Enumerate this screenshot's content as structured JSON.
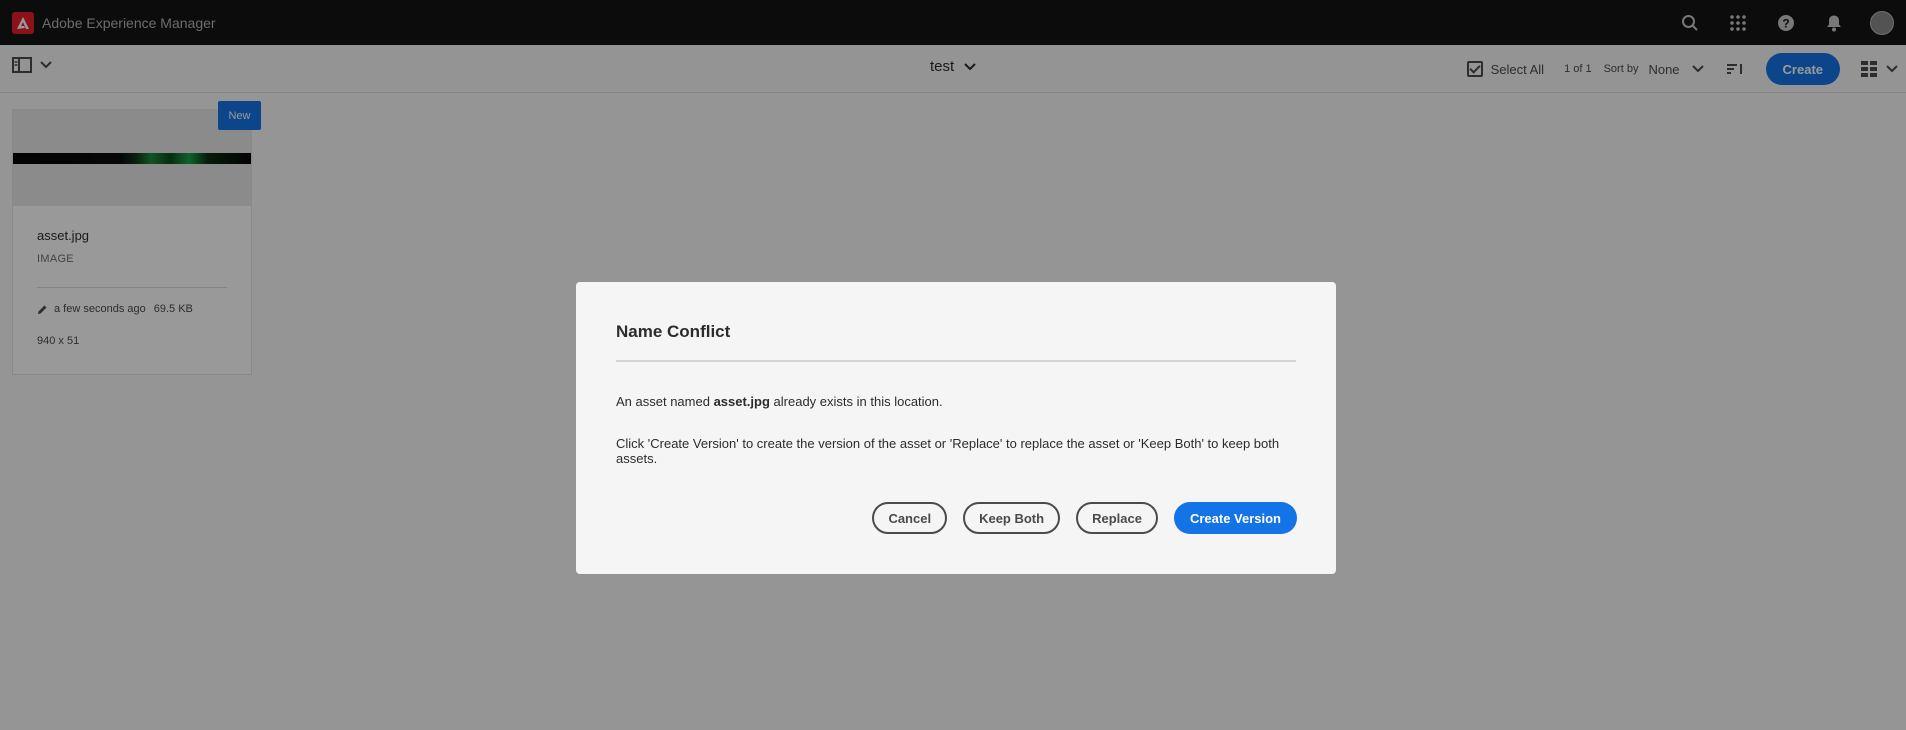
{
  "app": {
    "title": "Adobe Experience Manager"
  },
  "header": {
    "icons": [
      "search-icon",
      "apps-grid-icon",
      "help-icon",
      "notifications-icon",
      "user-avatar"
    ]
  },
  "actionbar": {
    "folder_title": "test",
    "select_all_label": "Select All",
    "count": "1 of 1",
    "sort_by_label": "Sort by",
    "sort_value": "None",
    "create_label": "Create"
  },
  "card": {
    "badge": "New",
    "name": "asset.jpg",
    "type": "IMAGE",
    "modified": "a few seconds ago",
    "size": "69.5 KB",
    "dimensions": "940 x 51"
  },
  "dialog": {
    "title": "Name Conflict",
    "line1_prefix": "An asset named ",
    "line1_filename": "asset.jpg",
    "line1_suffix": " already exists in this location.",
    "line2": "Click 'Create Version' to create the version of the asset or 'Replace' to replace the asset or 'Keep Both' to keep both assets.",
    "buttons": {
      "cancel": "Cancel",
      "keep_both": "Keep Both",
      "replace": "Replace",
      "create_version": "Create Version"
    }
  },
  "colors": {
    "accent": "#1473e6",
    "header_bg": "#141414",
    "brand_red": "#ea1f2b"
  }
}
